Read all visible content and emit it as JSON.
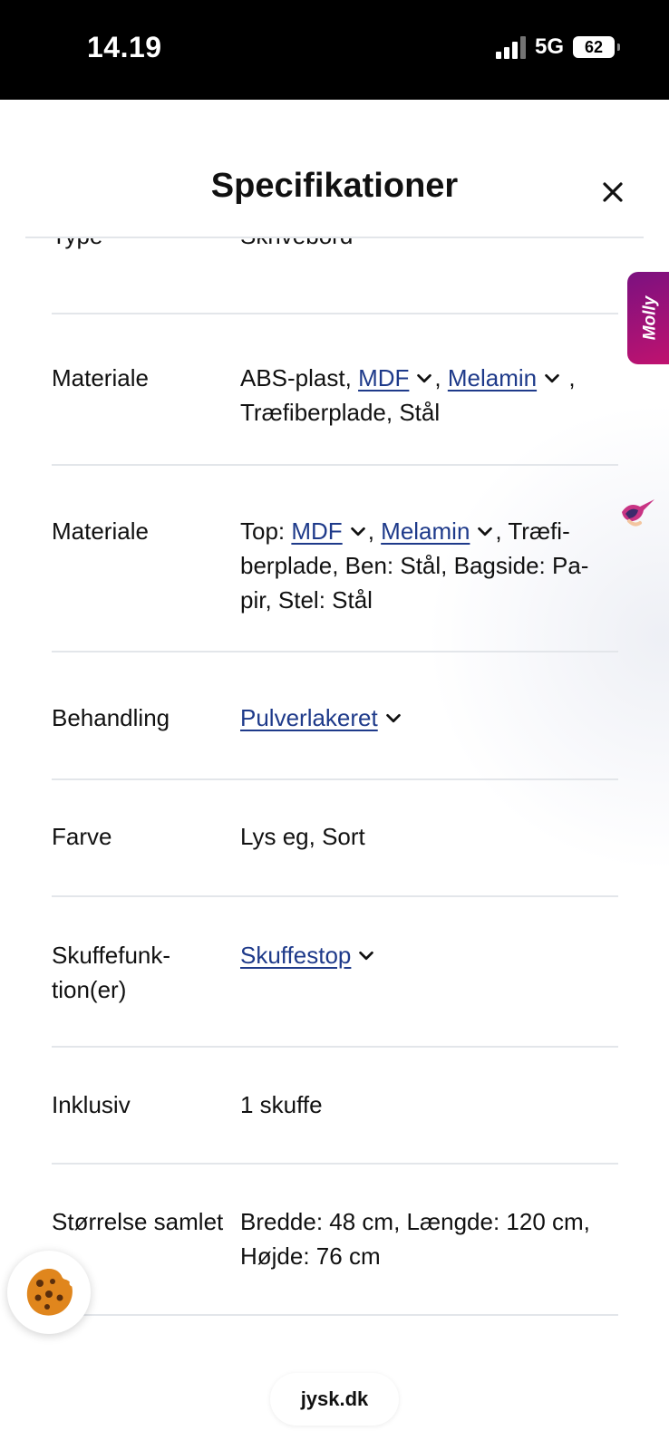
{
  "status_bar": {
    "time": "14.19",
    "network": "5G",
    "battery": "62"
  },
  "sheet": {
    "title": "Specifikationer",
    "close_icon": "close-icon"
  },
  "rows": [
    {
      "label": "Type",
      "value_text": "Skrivebord"
    },
    {
      "label": "Materiale",
      "value_line1_text": "ABS-plast, ",
      "link1": "MDF",
      "sep": ", ",
      "link2": "Melamin",
      "tail": ",",
      "value_line2": "Træfiberplade, Stål"
    },
    {
      "label": "Materiale",
      "prefix": "Top: ",
      "link1": "MDF",
      "sep": ", ",
      "link2": "Melamin",
      "tail": ", Træfi-",
      "value_line2": "berplade, Ben: Stål, Bagside: Pa-",
      "value_line3": "pir, Stel: Stål"
    },
    {
      "label": "Behandling",
      "link1": "Pulverlakeret"
    },
    {
      "label": "Farve",
      "value_text": "Lys eg, Sort"
    },
    {
      "label_line1": "Skuffefunk-",
      "label_line2": "tion(er)",
      "link1": "Skuffestop"
    },
    {
      "label": "Inklusiv",
      "value_text": "1 skuffe"
    },
    {
      "label": "Størrelse samlet",
      "value_line1": "Bredde: 48 cm, Længde: 120 cm,",
      "value_line2": "Højde: 76 cm"
    }
  ],
  "molly": {
    "label": "Molly"
  },
  "browser": {
    "url": "jysk.dk"
  },
  "colors": {
    "link": "#1e3a8a",
    "molly_start": "#7b1180",
    "molly_end": "#c0126f",
    "cookie": "#e0861d"
  }
}
